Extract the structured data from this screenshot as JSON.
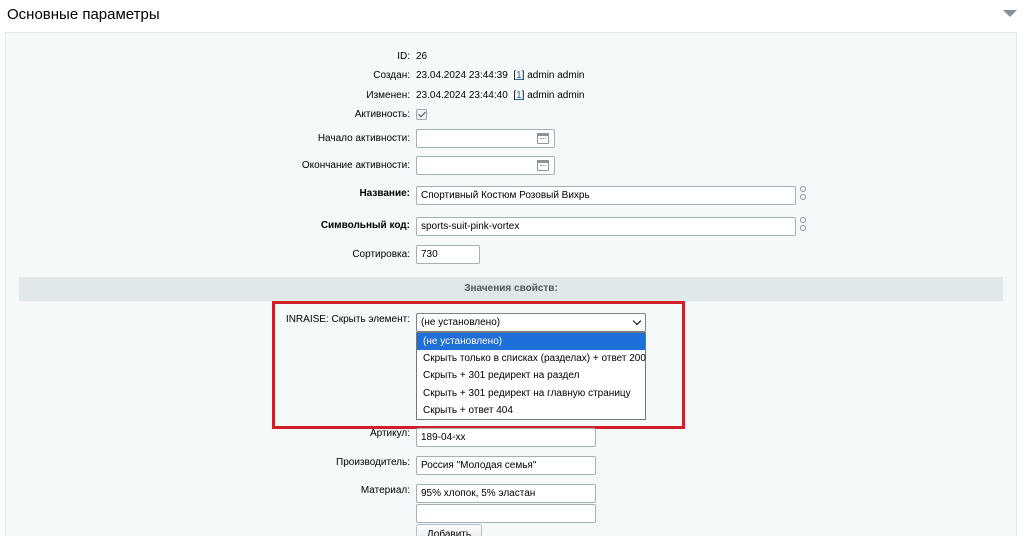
{
  "header": {
    "title": "Основные параметры"
  },
  "fields": {
    "id": {
      "label": "ID:",
      "value": "26"
    },
    "created": {
      "label": "Создан:",
      "date": "23.04.2024 23:44:39",
      "user_link": "1",
      "user": "admin admin"
    },
    "modified": {
      "label": "Изменен:",
      "date": "23.04.2024 23:44:40",
      "user_link": "1",
      "user": "admin admin"
    },
    "active": {
      "label": "Активность:",
      "checked": true
    },
    "active_from": {
      "label": "Начало активности:",
      "value": ""
    },
    "active_to": {
      "label": "Окончание активности:",
      "value": ""
    },
    "name": {
      "label": "Название:",
      "value": "Спортивный Костюм Розовый Вихрь"
    },
    "code": {
      "label": "Символьный код:",
      "value": "sports-suit-pink-vortex"
    },
    "sort": {
      "label": "Сортировка:",
      "value": "730"
    }
  },
  "section": {
    "title": "Значения свойств:"
  },
  "hide_element": {
    "label": "INRAISE: Скрыть элемент:",
    "selected": "(не установлено)",
    "options": [
      "(не установлено)",
      "Скрыть только в списках (разделах) + ответ 200",
      "Скрыть + 301 редирект на раздел",
      "Скрыть + 301 редирект на главную страницу",
      "Скрыть + ответ 404"
    ]
  },
  "properties": {
    "article": {
      "label": "Артикул:",
      "value": "189-04-xx"
    },
    "manufacturer": {
      "label": "Производитель:",
      "value": "Россия \"Молодая семья\""
    },
    "material": {
      "label": "Материал:",
      "value": "95% хлопок, 5% эластан",
      "value2": ""
    }
  },
  "add_button": {
    "label": "Добавить"
  },
  "colors": {
    "highlight_box": "#d11f29",
    "selected_option": "#1e6fd9",
    "section_bar": "#e0e8ea"
  }
}
